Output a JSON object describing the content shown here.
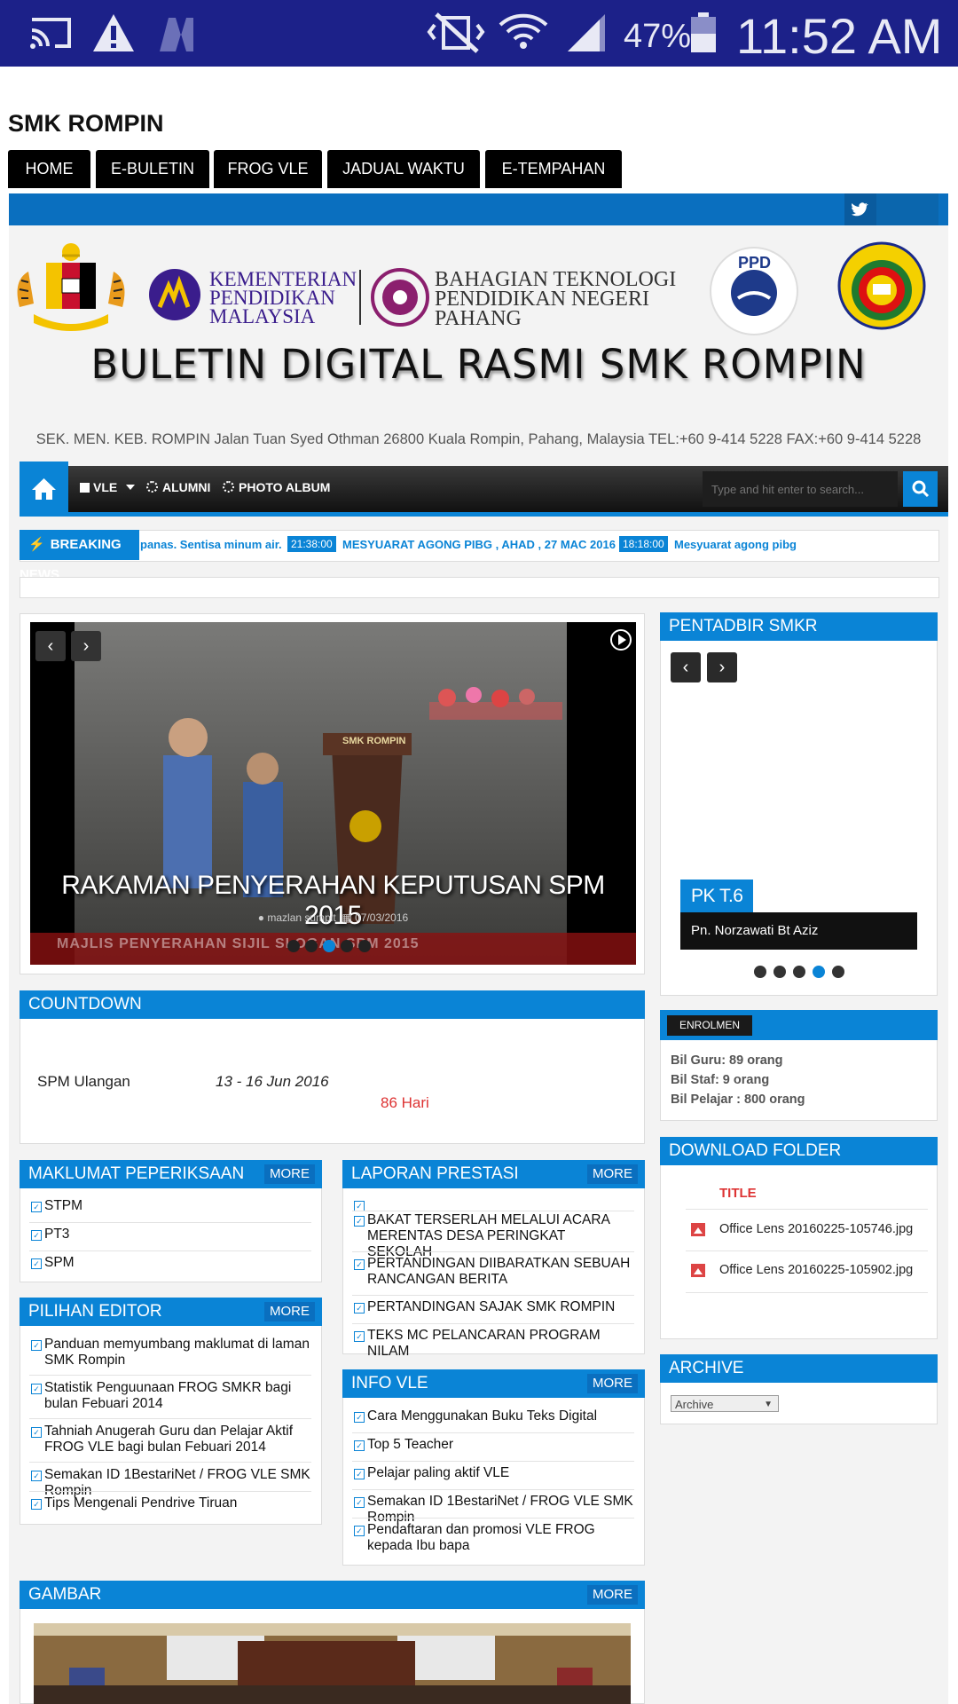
{
  "status_bar": {
    "battery": "47%",
    "time": "11:52 AM"
  },
  "site": {
    "title": "SMK ROMPIN",
    "menu": [
      "HOME",
      "E-BULETIN",
      "FROG VLE",
      "JADUAL WAKTU",
      "E-TEMPAHAN"
    ]
  },
  "banner": {
    "kpm_line1": "KEMENTERIAN",
    "kpm_line2": "PENDIDIKAN",
    "kpm_line3": "MALAYSIA",
    "btp_line1": "BAHAGIAN TEKNOLOGI",
    "btp_line2": "PENDIDIKAN NEGERI",
    "btp_line3": "PAHANG",
    "ppd": "PPD",
    "headline": "BULETIN DIGITAL RASMI SMK ROMPIN",
    "address": "SEK. MEN. KEB. ROMPIN Jalan Tuan Syed Othman 26800 Kuala Rompin, Pahang, Malaysia TEL:+60 9-414 5228 FAX:+60 9-414 5228"
  },
  "nav": {
    "items": [
      "VLE",
      "ALUMNI",
      "PHOTO ALBUM"
    ],
    "search_placeholder": "Type and hit enter to search..."
  },
  "breaking": {
    "label": "BREAKING NEWS",
    "lead": "panas. Sentisa minum air.",
    "items": [
      {
        "time": "21:38:00",
        "text": "MESYUARAT AGONG PIBG , AHAD , 27 MAC 2016"
      },
      {
        "time": "18:18:00",
        "text": "Mesyuarat agong pibg"
      }
    ]
  },
  "slider": {
    "caption": "RAKAMAN PENYERAHAN KEPUTUSAN SPM 2015",
    "author": "mazlan sumpit",
    "date": "07/03/2016",
    "ticker": "MAJLIS PENYERAHAN SIJIL SLOGAN SPM 2015",
    "podium_label": "SMK ROMPIN"
  },
  "pentadbir": {
    "title": "PENTADBIR SMKR",
    "role": "PK T.6",
    "name": "Pn. Norzawati Bt Aziz"
  },
  "countdown": {
    "title": "COUNTDOWN",
    "event": "SPM Ulangan",
    "dates": "13 - 16 Jun 2016",
    "remaining": "86 Hari"
  },
  "enrolmen": {
    "label": "ENROLMEN",
    "guru": "Bil Guru: 89 orang",
    "staf": "Bil Staf: 9 orang",
    "pelajar": "Bil Pelajar : 800 orang"
  },
  "download": {
    "title": "DOWNLOAD FOLDER",
    "col": "TITLE",
    "files": [
      "Office Lens 20160225-105746.jpg",
      "Office Lens 20160225-105902.jpg"
    ]
  },
  "archive": {
    "title": "ARCHIVE",
    "select": "Archive"
  },
  "more_label": "MORE",
  "maklumat": {
    "title": "MAKLUMAT PEPERIKSAAN",
    "items": [
      "STPM",
      "PT3",
      "SPM"
    ]
  },
  "laporan": {
    "title": "LAPORAN PRESTASI",
    "items": [
      "BAKAT TERSERLAH MELALUI ACARA MERENTAS DESA PERINGKAT SEKOLAH",
      "PERTANDINGAN DIIBARATKAN SEBUAH RANCANGAN BERITA",
      "PERTANDINGAN SAJAK SMK ROMPIN",
      "TEKS MC PELANCARAN PROGRAM NILAM"
    ]
  },
  "editor": {
    "title": "PILIHAN EDITOR",
    "items": [
      "Panduan memyumbang maklumat di laman SMK Rompin",
      "Statistik Penguunaan FROG SMKR bagi bulan Febuari 2014",
      "Tahniah Anugerah Guru dan Pelajar Aktif FROG VLE bagi bulan Febuari 2014",
      "Semakan ID 1BestariNet / FROG VLE SMK Rompin",
      "Tips Mengenali Pendrive Tiruan"
    ]
  },
  "infovle": {
    "title": "INFO VLE",
    "items": [
      "Cara Menggunakan Buku Teks Digital",
      "Top 5 Teacher",
      "Pelajar paling aktif VLE",
      "Semakan ID 1BestariNet / FROG VLE SMK Rompin",
      "Pendaftaran dan promosi VLE FROG kepada Ibu bapa"
    ]
  },
  "gambar": {
    "title": "GAMBAR"
  }
}
